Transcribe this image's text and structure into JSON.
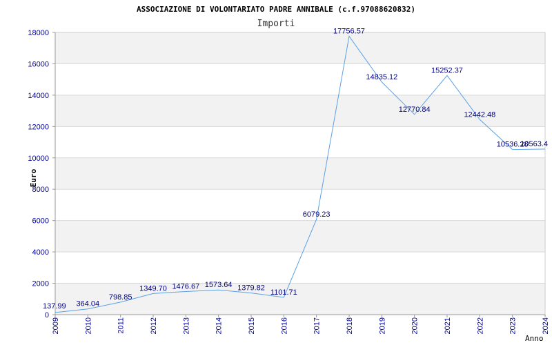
{
  "chart_data": {
    "type": "line",
    "title": "ASSOCIAZIONE DI VOLONTARIATO PADRE ANNIBALE (c.f.97088620832)",
    "subtitle": "Importi",
    "xlabel": "Anno",
    "ylabel": "Euro",
    "ylim": [
      0,
      18000
    ],
    "y_ticks": [
      "0",
      "2000",
      "4000",
      "6000",
      "8000",
      "10000",
      "12000",
      "14000",
      "16000",
      "18000"
    ],
    "grid": true,
    "categories": [
      "2009",
      "2010",
      "2011",
      "2012",
      "2013",
      "2014",
      "2015",
      "2016",
      "2017",
      "2018",
      "2019",
      "2020",
      "2021",
      "2022",
      "2023",
      "2024"
    ],
    "values": [
      137.99,
      364.04,
      798.85,
      1349.7,
      1476.67,
      1573.64,
      1379.82,
      1101.71,
      6079.23,
      17756.57,
      14835.12,
      12770.84,
      15252.37,
      12442.48,
      10536.28,
      10563.4
    ],
    "data_labels": [
      "137.99",
      "364.04",
      "798.85",
      "1349.70",
      "1476.67",
      "1573.64",
      "1379.82",
      "1101.71",
      "6079.23",
      "17756.57",
      "14835.12",
      "12770.84",
      "15252.37",
      "12442.48",
      "10536.28",
      "10563.4"
    ],
    "line_color": "#5aa0e6",
    "band_color": "#f2f2f2",
    "tick_color": "#0000aa",
    "label_color": "#000080"
  }
}
